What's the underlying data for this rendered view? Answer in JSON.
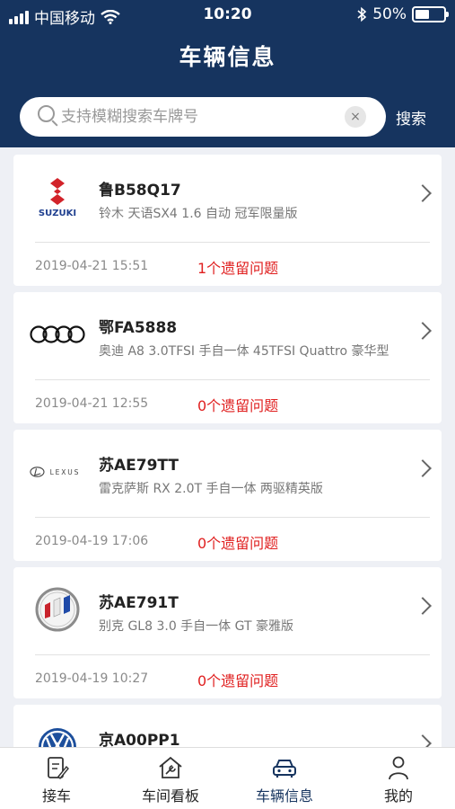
{
  "status_bar": {
    "carrier": "中国移动",
    "time": "10:20",
    "battery": "50%",
    "battery_level": 0.5
  },
  "header": {
    "title": "车辆信息"
  },
  "search": {
    "placeholder": "支持模糊搜索车牌号",
    "clear_icon": "×",
    "button_label": "搜索"
  },
  "vehicles": [
    {
      "plate": "鲁B58Q17",
      "model": "铃木 天语SX4 1.6 自动 冠军限量版",
      "date": "2019-04-21 15:51",
      "issues": "1个遗留问题",
      "logo": "suzuki",
      "logo_text": "SUZUKI"
    },
    {
      "plate": "鄂FA5888",
      "model": "奥迪 A8 3.0TFSI 手自一体 45TFSI Quattro 豪华型",
      "date": "2019-04-21 12:55",
      "issues": "0个遗留问题",
      "logo": "audi"
    },
    {
      "plate": "苏AE79TT",
      "model": "雷克萨斯 RX 2.0T 手自一体 两驱精英版",
      "date": "2019-04-19 17:06",
      "issues": "0个遗留问题",
      "logo": "lexus",
      "logo_text": "LEXUS"
    },
    {
      "plate": "苏AE791T",
      "model": "别克 GL8 3.0 手自一体 GT 豪雅版",
      "date": "2019-04-19 10:27",
      "issues": "0个遗留问题",
      "logo": "buick"
    },
    {
      "plate": "京A00PP1",
      "model": "",
      "date": "",
      "issues": "",
      "logo": "volkswagen"
    }
  ],
  "tabs": [
    {
      "label": "接车",
      "icon": "clipboard-icon",
      "active": false
    },
    {
      "label": "车间看板",
      "icon": "workshop-icon",
      "active": false
    },
    {
      "label": "车辆信息",
      "icon": "car-icon",
      "active": true
    },
    {
      "label": "我的",
      "icon": "person-icon",
      "active": false
    }
  ],
  "colors": {
    "header_bg": "#16345f",
    "issue_red": "#e02020",
    "active_tab": "#16345f"
  }
}
